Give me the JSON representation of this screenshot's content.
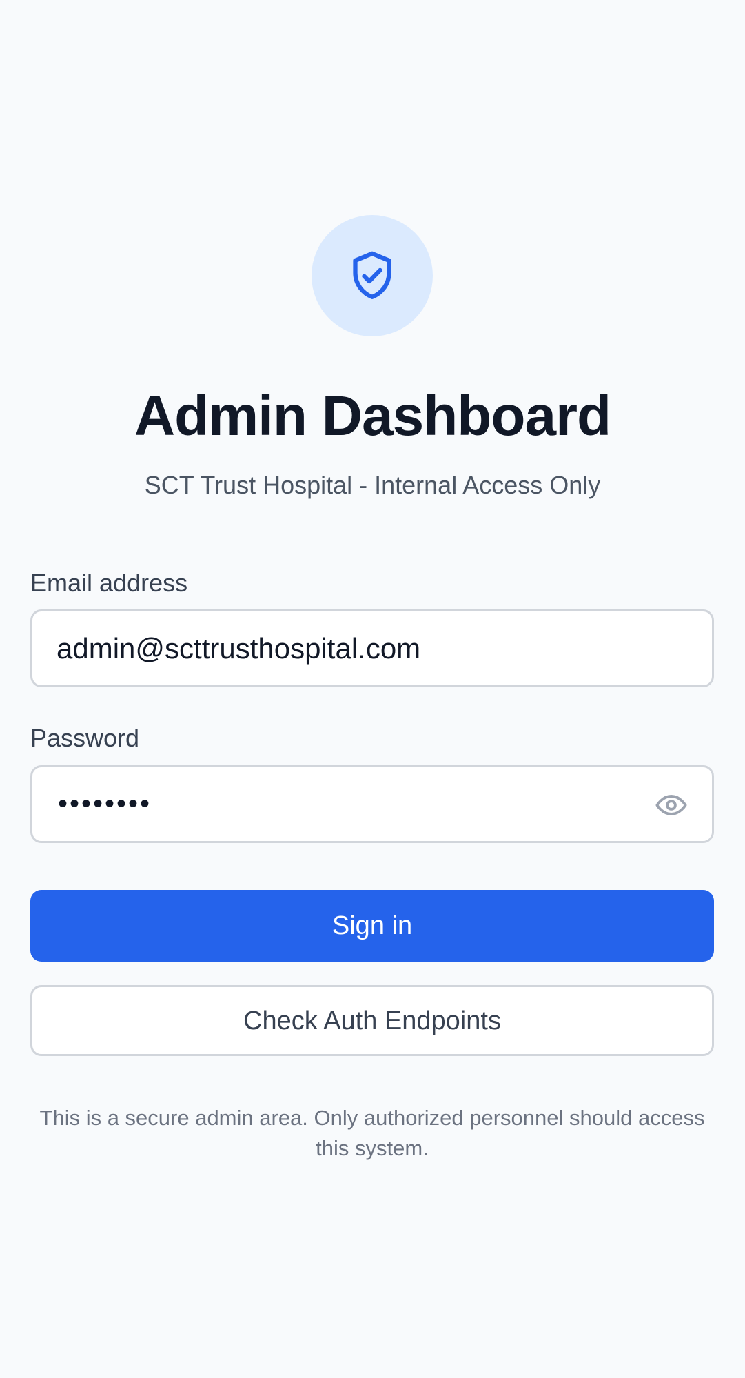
{
  "header": {
    "logo_icon": "shield-check-icon",
    "title": "Admin Dashboard",
    "subtitle": "SCT Trust Hospital - Internal Access Only"
  },
  "form": {
    "email_label": "Email address",
    "email_value": "admin@scttrusthospital.com",
    "password_label": "Password",
    "password_mask": "••••••••",
    "password_toggle_icon": "eye-icon",
    "sign_in_label": "Sign in",
    "check_auth_label": "Check Auth Endpoints"
  },
  "footer": {
    "notice": "This is a secure admin area. Only authorized personnel should access this system."
  },
  "colors": {
    "background": "#f8fafc",
    "accent": "#2563eb",
    "accent_soft": "#dbeafe",
    "title_text": "#111827",
    "muted_text": "#4b5563"
  }
}
